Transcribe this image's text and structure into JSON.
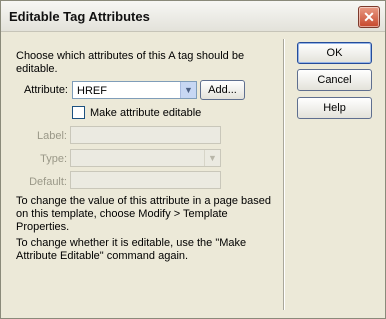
{
  "window": {
    "title": "Editable Tag Attributes",
    "close_label": "✕"
  },
  "main": {
    "description": "Choose which attributes of this A tag should be editable.",
    "attribute_label": "Attribute:",
    "attribute_value": "HREF",
    "add_button_label": "Add...",
    "make_editable_label": "Make attribute editable",
    "make_editable_checked": false,
    "label_label": "Label:",
    "label_value": "",
    "type_label": "Type:",
    "type_value": "",
    "default_label": "Default:",
    "default_value": "",
    "note1": "To change the value of this attribute in a page based on this template, choose Modify > Template Properties.",
    "note2": "To change whether it is editable, use the \"Make Attribute Editable\" command again."
  },
  "buttons": {
    "ok": "OK",
    "cancel": "Cancel",
    "help": "Help"
  },
  "icons": {
    "close": "close-icon",
    "dropdown": "chevron-down-icon"
  },
  "colors": {
    "close_red": "#c7482c",
    "dialog_bg": "#ece9d8",
    "disabled_text": "#9a9888"
  }
}
